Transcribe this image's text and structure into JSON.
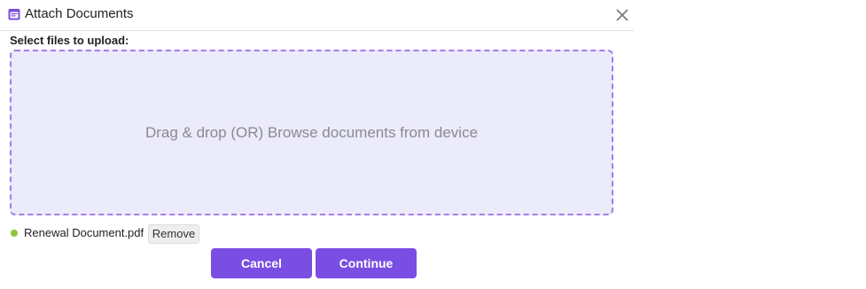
{
  "dialog": {
    "title": "Attach Documents",
    "icon": "calendar-doc-icon",
    "close_icon": "close-icon"
  },
  "upload": {
    "label": "Select files to upload:",
    "dropzone_text": "Drag & drop (OR) Browse documents from device"
  },
  "files": [
    {
      "name": "Renewal Document.pdf",
      "remove_label": "Remove",
      "status_color": "#8ec63f"
    }
  ],
  "actions": {
    "cancel_label": "Cancel",
    "continue_label": "Continue"
  },
  "colors": {
    "accent": "#7a4de3",
    "dropzone_bg": "#ebebfb",
    "dropzone_border": "#a77ce6"
  }
}
